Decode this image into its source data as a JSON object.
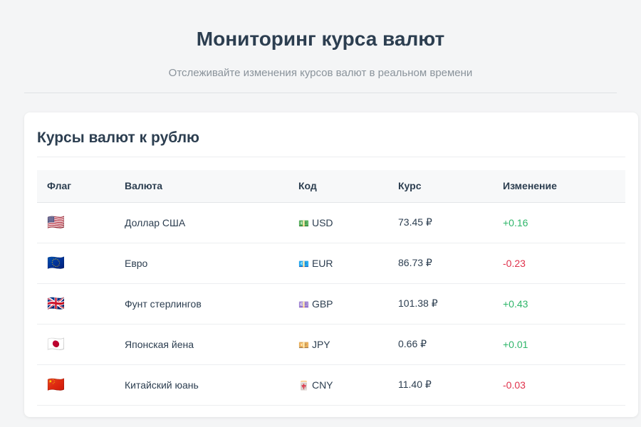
{
  "header": {
    "title": "Мониторинг курса валют",
    "subtitle": "Отслеживайте изменения курсов валют в реальном времени"
  },
  "card": {
    "title": "Курсы валют к рублю",
    "columns": [
      "Флаг",
      "Валюта",
      "Код",
      "Курс",
      "Изменение"
    ],
    "rows": [
      {
        "flag": "🇺🇸",
        "name": "Доллар США",
        "code_icon": "💵",
        "code": "USD",
        "rate": "73.45 ₽",
        "change": "+0.16",
        "trend": "up"
      },
      {
        "flag": "🇪🇺",
        "name": "Евро",
        "code_icon": "💶",
        "code": "EUR",
        "rate": "86.73 ₽",
        "change": "-0.23",
        "trend": "down"
      },
      {
        "flag": "🇬🇧",
        "name": "Фунт стерлингов",
        "code_icon": "💷",
        "code": "GBP",
        "rate": "101.38 ₽",
        "change": "+0.43",
        "trend": "up"
      },
      {
        "flag": "🇯🇵",
        "name": "Японская йена",
        "code_icon": "💴",
        "code": "JPY",
        "rate": "0.66 ₽",
        "change": "+0.01",
        "trend": "up"
      },
      {
        "flag": "🇨🇳",
        "name": "Китайский юань",
        "code_icon": "🀄",
        "code": "CNY",
        "rate": "11.40 ₽",
        "change": "-0.03",
        "trend": "down"
      }
    ]
  },
  "colors": {
    "positive": "#2fb66a",
    "negative": "#e0314b"
  }
}
